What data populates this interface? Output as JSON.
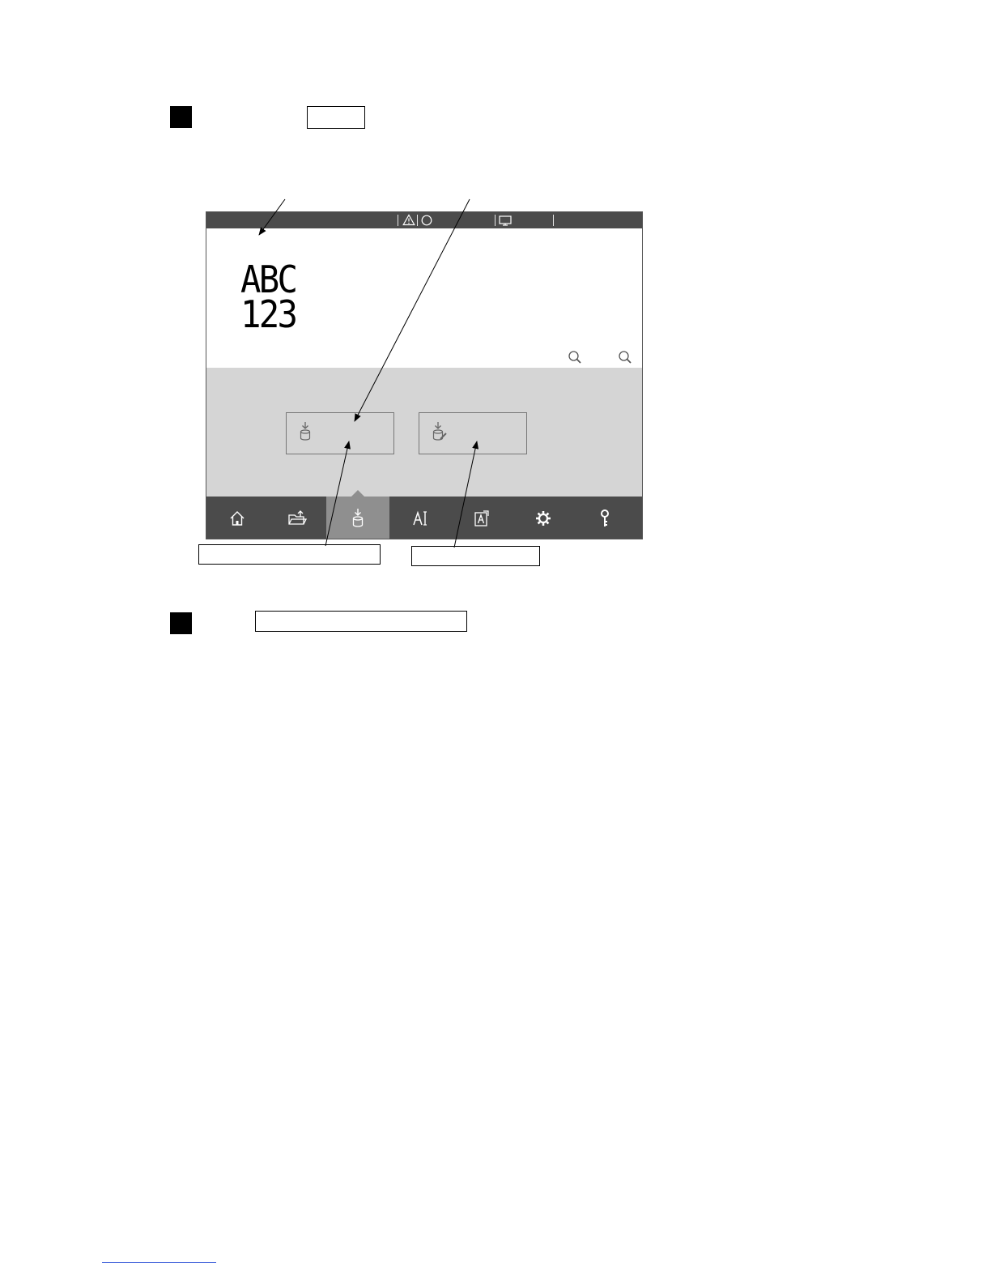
{
  "document": {
    "step_markers": [
      "",
      ""
    ],
    "blank_labels": [
      "",
      "",
      "",
      ""
    ]
  },
  "screen": {
    "status_icons": [
      "warning-icon",
      "status-circle-icon",
      "monitor-icon"
    ],
    "preview": {
      "line1": "ABC",
      "line2": "123"
    },
    "zoom_icons": [
      "zoom-in-icon",
      "zoom-out-icon"
    ],
    "panel_buttons": [
      {
        "icon": "database-download-icon",
        "label": ""
      },
      {
        "icon": "database-edit-icon",
        "label": ""
      }
    ],
    "nav": [
      {
        "icon": "home-icon"
      },
      {
        "icon": "folder-open-icon"
      },
      {
        "icon": "database-download-icon",
        "active": true
      },
      {
        "icon": "text-edit-icon"
      },
      {
        "icon": "text-frame-icon"
      },
      {
        "icon": "gear-icon"
      },
      {
        "icon": "key-icon"
      }
    ],
    "colors": {
      "bar": "#4b4b4b",
      "panel": "#d5d5d5",
      "active_nav": "#8f8f8f"
    }
  }
}
